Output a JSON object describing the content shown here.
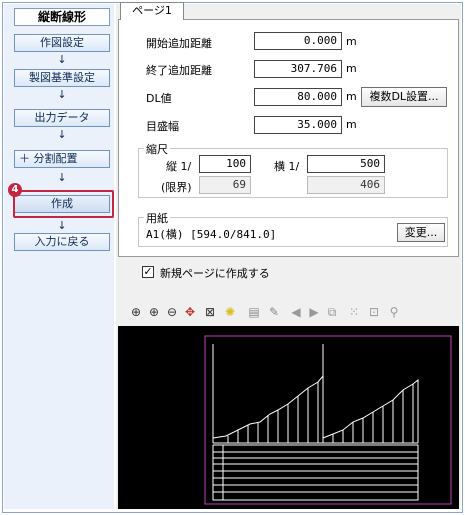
{
  "sidebar": {
    "title": "縦断線形",
    "items": [
      {
        "label": "作図設定"
      },
      {
        "label": "製図基準設定"
      },
      {
        "label": "出力データ"
      },
      {
        "label": "＋ 分割配置"
      },
      {
        "label": "作成"
      },
      {
        "label": "入力に戻る"
      }
    ],
    "arrow": "↓",
    "step_badge": "4"
  },
  "tab": {
    "label": "ページ1"
  },
  "fields": {
    "start_distance": {
      "label": "開始追加距離",
      "value": "0.000",
      "unit": "m"
    },
    "end_distance": {
      "label": "終了追加距離",
      "value": "307.706",
      "unit": "m"
    },
    "dl_value": {
      "label": "DL値",
      "value": "80.000",
      "unit": "m",
      "button": "複数DL設置..."
    },
    "scale_width": {
      "label": "目盛幅",
      "value": "35.000",
      "unit": "m"
    }
  },
  "scale": {
    "title": "縮尺",
    "vertical_label": "縦 1/",
    "vertical_value": "100",
    "horizontal_label": "横 1/",
    "horizontal_value": "500",
    "limit_label": "(限界)",
    "limit_vertical": "69",
    "limit_horizontal": "406"
  },
  "paper": {
    "title": "用紙",
    "value": "A1(横) [594.0/841.0]",
    "change_button": "変更..."
  },
  "new_page": {
    "label": "新規ページに作成する",
    "checked": true
  },
  "toolbar_icons": [
    "zoom-fit-icon",
    "zoom-in-icon",
    "zoom-out-icon",
    "pan-icon",
    "window-zoom-icon",
    "bulb-icon",
    "page-icon",
    "pen-icon",
    "prev-icon",
    "next-icon",
    "layout-icon",
    "grid-icon",
    "move-icon",
    "pin-icon"
  ],
  "colors": {
    "accent": "#c4263f",
    "sidebar_bg": "#eaf1fb",
    "preview_bg": "#000000",
    "sheet_border": "#c040c0"
  }
}
